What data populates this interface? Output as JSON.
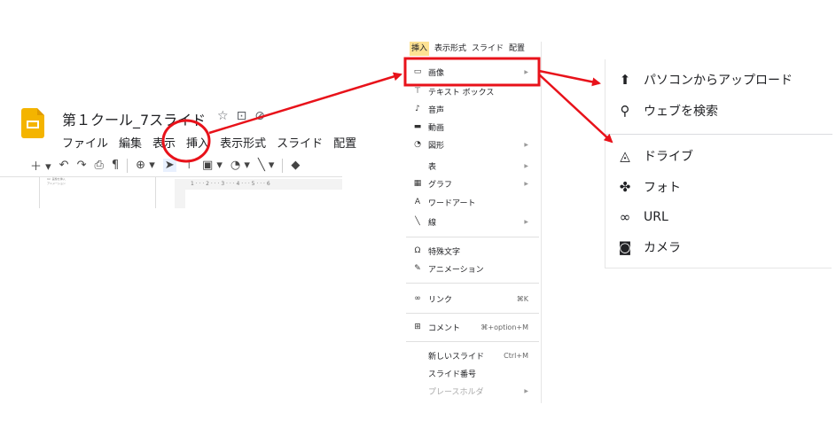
{
  "app": {
    "doc_title": "第１クール_7スライド",
    "title_icons": [
      "star-icon",
      "move-folder-icon",
      "cloud-status-icon"
    ],
    "menu": [
      "ファイル",
      "編集",
      "表示",
      "挿入",
      "表示形式",
      "スライド",
      "配置"
    ],
    "thumbnail_lines": [
      "02. 画像を挿入",
      "アニメーション"
    ],
    "ruler": "1 · · · 2 · · · 3 · · · 4 · · · 5 · · · 6"
  },
  "insert_menu": {
    "header": [
      "挿入",
      "表示形式",
      "スライド",
      "配置"
    ],
    "items": [
      {
        "label": "画像",
        "icon": "image-icon",
        "submenu": true,
        "highlighted": true
      },
      {
        "label": "テキスト ボックス",
        "icon": "text-box-icon"
      },
      {
        "label": "音声",
        "icon": "audio-icon"
      },
      {
        "label": "動画",
        "icon": "video-icon"
      },
      {
        "label": "図形",
        "icon": "shape-icon",
        "submenu": true
      },
      {
        "label": "表",
        "icon": "",
        "submenu": true
      },
      {
        "label": "グラフ",
        "icon": "chart-icon",
        "submenu": true
      },
      {
        "label": "ワードアート",
        "icon": "word-art-icon"
      },
      {
        "label": "線",
        "icon": "line-icon",
        "submenu": true
      },
      {
        "label": "特殊文字",
        "icon": "omega-icon"
      },
      {
        "label": "アニメーション",
        "icon": "animation-icon"
      },
      {
        "label": "リンク",
        "icon": "link-icon",
        "shortcut": "⌘K"
      },
      {
        "label": "コメント",
        "icon": "comment-icon",
        "shortcut": "⌘+option+M"
      },
      {
        "label": "新しいスライド",
        "icon": "",
        "shortcut": "Ctrl+M"
      },
      {
        "label": "スライド番号",
        "icon": ""
      },
      {
        "label": "プレースホルダ",
        "icon": "",
        "submenu": true,
        "disabled": true
      }
    ]
  },
  "image_submenu": {
    "items": [
      {
        "label": "パソコンからアップロード",
        "icon": "upload-icon"
      },
      {
        "label": "ウェブを検索",
        "icon": "search-icon"
      },
      {
        "label": "ドライブ",
        "icon": "drive-icon"
      },
      {
        "label": "フォト",
        "icon": "photos-icon"
      },
      {
        "label": "URL",
        "icon": "link-icon"
      },
      {
        "label": "カメラ",
        "icon": "camera-icon"
      }
    ]
  },
  "colors": {
    "annotation_red": "#e8121a",
    "slides_yellow": "#f4b400",
    "menu_highlight": "#fde293"
  }
}
